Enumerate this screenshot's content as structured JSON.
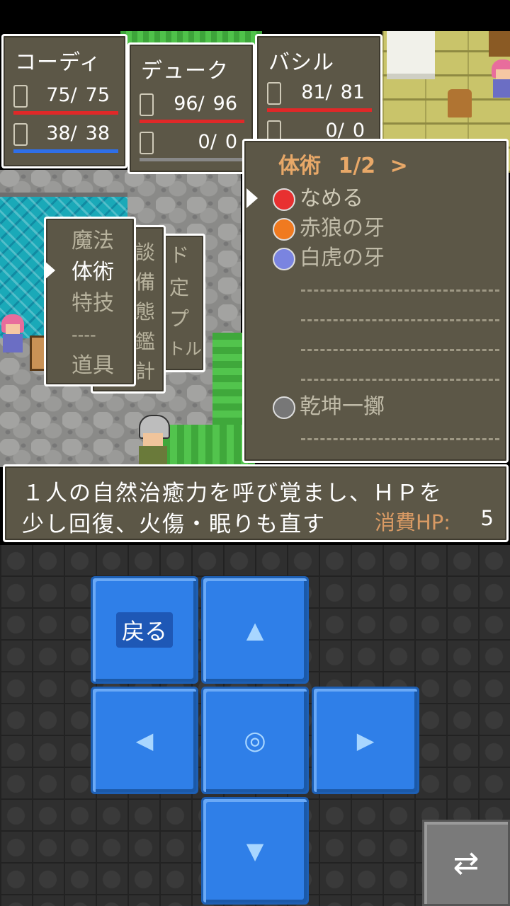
{
  "party": [
    {
      "name": "コーディ",
      "hp": "75/",
      "hp_max": "75",
      "mp": "38/",
      "mp_max": "38"
    },
    {
      "name": "デューク",
      "hp": "96/",
      "hp_max": "96",
      "mp": "0/",
      "mp_max": "0"
    },
    {
      "name": "バシル",
      "hp": "81/",
      "hp_max": "81",
      "mp": "0/",
      "mp_max": "0"
    }
  ],
  "command_menu": {
    "items": [
      "魔法",
      "体術",
      "特技",
      "----",
      "道具"
    ],
    "selected": "体術"
  },
  "back_menu_1": {
    "chars": [
      "談",
      "備",
      "態",
      "鑑",
      "計"
    ]
  },
  "back_menu_2": {
    "chars": [
      "ド",
      "定",
      "プ",
      "トル"
    ]
  },
  "skill_window": {
    "title": "体術",
    "page": "1/2",
    "next_arrow": ">",
    "skills": [
      {
        "name": "なめる",
        "icon": "heart-icon"
      },
      {
        "name": "赤狼の牙",
        "icon": "fire-icon"
      },
      {
        "name": "白虎の牙",
        "icon": "ice-icon"
      },
      {
        "name": "乾坤一擲",
        "icon": "sword-icon"
      }
    ]
  },
  "description": {
    "line1": "１人の自然治癒力を呼び覚まし、ＨＰを",
    "line2": "少し回復、火傷・眠りも直す",
    "cost_label": "消費HP:",
    "cost_value": "5"
  },
  "controls": {
    "back_label": "戻る",
    "up_icon": "▲",
    "down_icon": "▼",
    "left_icon": "◀",
    "right_icon": "▶",
    "center_icon": "◎",
    "swap_icon": "⇄"
  },
  "colors": {
    "hp_bar": "#e02828",
    "mp_bar": "#2f6fe8",
    "panel": "#5c5747",
    "pad": "#2f7fe8"
  }
}
